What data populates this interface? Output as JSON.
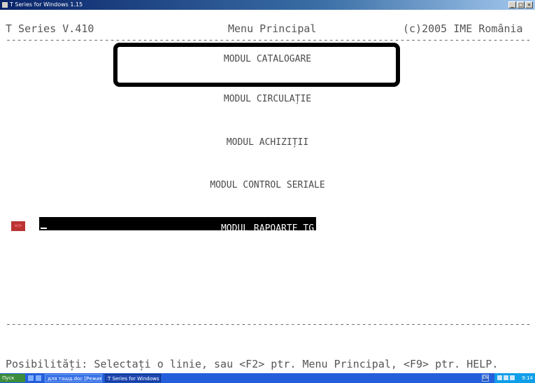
{
  "window": {
    "title": "T Series for Windows 1.15",
    "buttons": [
      "_",
      "□",
      "×"
    ]
  },
  "header": {
    "left": "T Series V.410",
    "center": "Menu Principal",
    "right": "(c)2005 IME România"
  },
  "separator": "------------------------------------------------------------------------------------------------",
  "menu": {
    "items": [
      "MODUL CATALOGARE",
      "MODUL CIRCULAȚIE",
      "MODUL ACHIZIȚII",
      "MODUL CONTROL SERIALE",
      "MODUL RAPOARTE TG"
    ],
    "selected_index": 4,
    "marker": "=>"
  },
  "status": "Posibilități: Selectați o linie, sau <F2> ptr. Menu Principal, <F9> ptr. HELP.",
  "taskbar": {
    "start_label": "Пуск",
    "tasks": [
      "для ташд.doc [Режим ог...",
      "T Series for Windows ..."
    ],
    "keyboard_layout": "EN",
    "clock": "9:14"
  },
  "colors": {
    "titlebar": "#0a246a",
    "taskbar": "#245edb",
    "selection": "#000000",
    "marker": "#b33333"
  }
}
